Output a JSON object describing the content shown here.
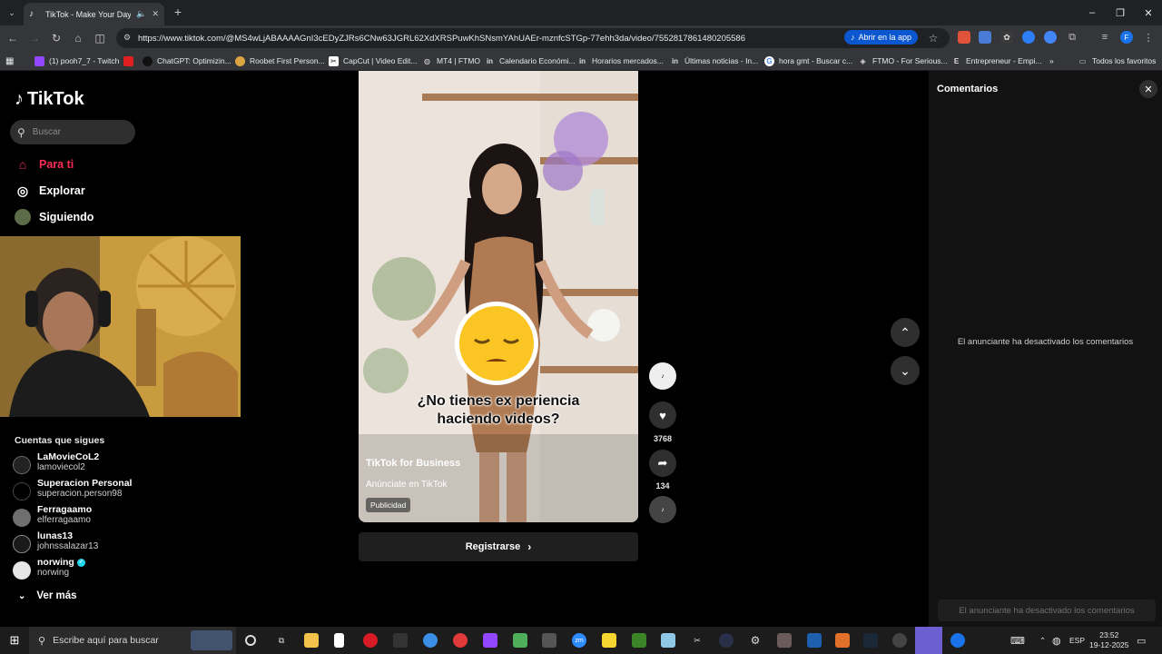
{
  "browser": {
    "tab_title": "TikTok - Make Your Day",
    "url": "https://www.tiktok.com/@MS4wLjABAAAAGnI3cEDyZJRs6CNw63JGRL62XdXRSPuwKhSNsmYAhUAEr-mznfcSTGp-77ehh3da/video/7552817861480205586",
    "open_app_label": "Abrir en la app",
    "bookmarks": [
      "(1) pooh7_7 - Twitch",
      "ChatGPT: Optimizin...",
      "Roobet First Person...",
      "CapCut | Video Edit...",
      "MT4 | FTMO",
      "Calendario Económi...",
      "Horarios mercados...",
      "Últimas noticias - In...",
      "hora gmt - Buscar c...",
      "FTMO - For Serious...",
      "Entrepreneur - Empi..."
    ],
    "all_bookmarks_label": "Todos los favoritos"
  },
  "sidebar": {
    "logo_text": "TikTok",
    "search_placeholder": "Buscar",
    "nav": [
      {
        "label": "Para ti",
        "icon": "home-icon"
      },
      {
        "label": "Explorar",
        "icon": "compass-icon"
      },
      {
        "label": "Siguiendo",
        "icon": "following-icon"
      }
    ],
    "following_title": "Cuentas que sigues",
    "accounts": [
      {
        "name": "LaMovieCoL2",
        "handle": "lamoviecol2"
      },
      {
        "name": "Superacion Personal",
        "handle": "superacion.person98"
      },
      {
        "name": "Ferragaamo",
        "handle": "elferragaamo"
      },
      {
        "name": "lunas13",
        "handle": "johnssalazar13"
      },
      {
        "name": "norwing",
        "handle": "norwing"
      }
    ],
    "see_more": "Ver más"
  },
  "video": {
    "caption_line1": "¿No tienes ex periencia",
    "caption_line2": "haciendo videos?",
    "author": "TikTok for Business",
    "subtitle": "Anúnciate en TikTok",
    "tag": "Publicidad",
    "register_label": "Registrarse",
    "likes": "3768",
    "shares": "134"
  },
  "comments": {
    "title": "Comentarios",
    "disabled_message": "El anunciante ha desactivado los comentarios",
    "input_placeholder": "El anunciante ha desactivado los comentarios"
  },
  "taskbar": {
    "search_placeholder": "Escribe aquí para buscar",
    "language": "ESP",
    "time": "23:52",
    "date": "19-12-2025"
  },
  "colors": {
    "accent": "#fe2c55",
    "chrome_dark": "#202124",
    "chrome_mid": "#35363a",
    "page_bg": "#000000"
  }
}
